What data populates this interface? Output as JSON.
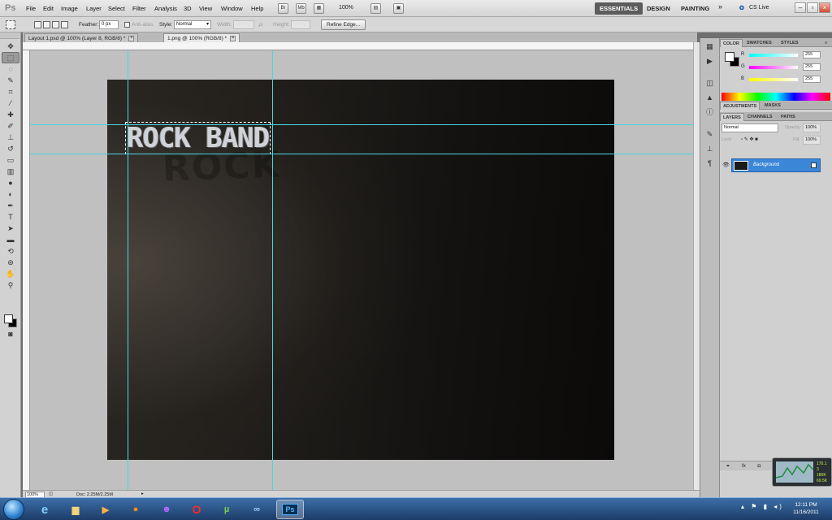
{
  "menubar": {
    "app_logo": "Ps",
    "items": [
      "File",
      "Edit",
      "Image",
      "Layer",
      "Select",
      "Filter",
      "Analysis",
      "3D",
      "View",
      "Window",
      "Help"
    ],
    "br_label": "Br",
    "mb_label": "Mb",
    "zoom": "100%",
    "workspaces": [
      "ESSENTIALS",
      "DESIGN",
      "PAINTING"
    ],
    "more": "»",
    "cslive": "CS Live"
  },
  "options": {
    "feather_label": "Feather:",
    "feather_value": "0 px",
    "antialias_label": "Anti-alias",
    "style_label": "Style:",
    "style_value": "Normal",
    "width_label": "Width:",
    "height_label": "Height:",
    "refine_label": "Refine Edge..."
  },
  "tabs": [
    {
      "label": "Layout 1.psd @ 100% (Layer 8, RGB/8) *"
    },
    {
      "label": "1.png @ 100% (RGB/8) *"
    }
  ],
  "canvas": {
    "headline": "ROCK BAND",
    "shadow_text": "ROCK"
  },
  "status": {
    "zoom": "100%",
    "doc_info": "Doc: 2.25M/2.25M"
  },
  "panels": {
    "color_tabs": [
      "COLOR",
      "SWATCHES",
      "STYLES"
    ],
    "sliders": [
      {
        "label": "R",
        "value": "255"
      },
      {
        "label": "G",
        "value": "255"
      },
      {
        "label": "B",
        "value": "255"
      }
    ],
    "adjust_tabs": [
      "ADJUSTMENTS",
      "MASKS"
    ],
    "layer_tabs": [
      "LAYERS",
      "CHANNELS",
      "PATHS"
    ],
    "blend_mode": "Normal",
    "opacity_label": "Opacity:",
    "opacity_value": "100%",
    "lock_label": "Lock:",
    "fill_label": "Fill:",
    "fill_value": "100%",
    "layer_name": "Background"
  },
  "taskbar": {
    "ps_label": "Ps",
    "time": "12:11 PM",
    "date": "11/16/2011"
  },
  "widget": {
    "lines": [
      "170.1",
      "3",
      "180K",
      "69.5K"
    ]
  }
}
